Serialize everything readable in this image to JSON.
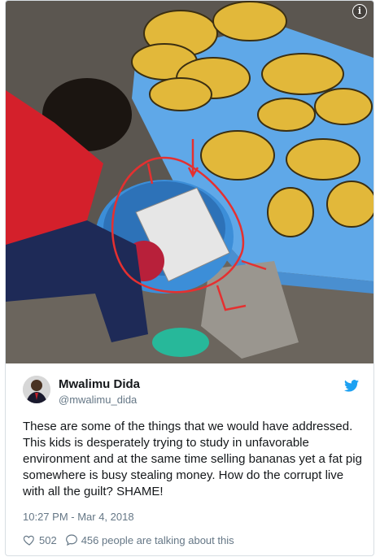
{
  "photo": {
    "info_icon": "info-icon",
    "description_icon": "photo"
  },
  "tweet": {
    "author_name": "Mwalimu Dida",
    "author_handle": "@mwalimu_dida",
    "text": "These are some of the things that we would have addressed. This kids is desperately trying to study in unfavorable environment and at the same time selling bananas yet a fat pig somewhere is busy stealing money. How do the corrupt live with all the guilt? SHAME!",
    "timestamp": "10:27 PM - Mar 4, 2018",
    "likes": "502",
    "replies_text": "456 people are talking about this"
  },
  "colors": {
    "text_primary": "#14171a",
    "text_secondary": "#657786",
    "twitter_blue": "#1da1f2",
    "border": "#d8dee3"
  }
}
